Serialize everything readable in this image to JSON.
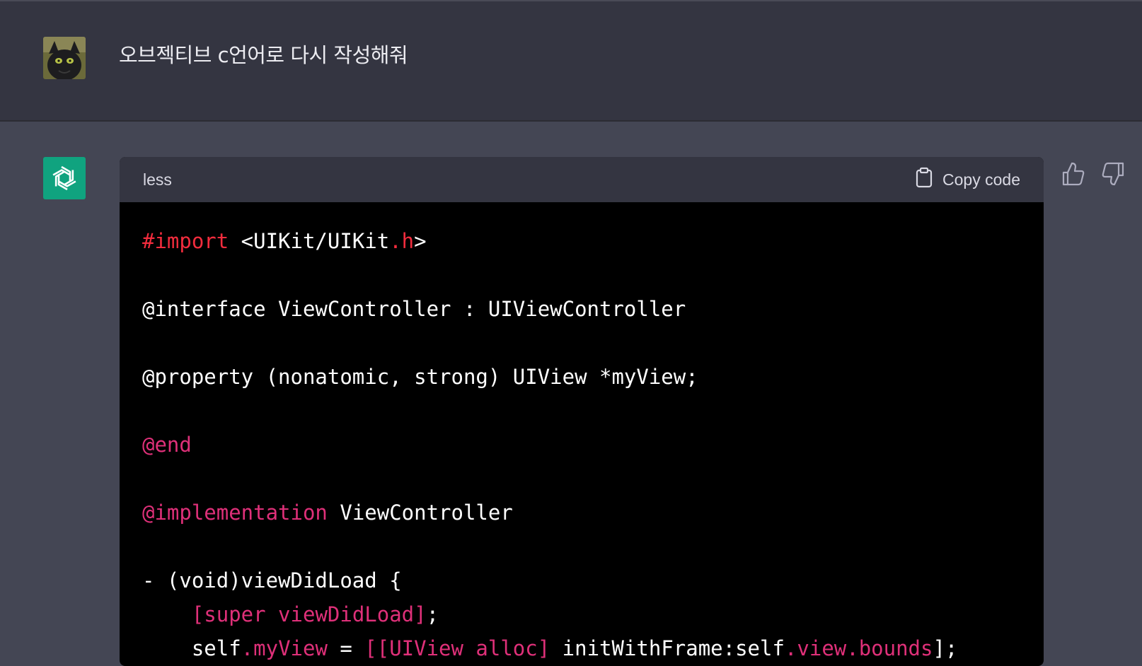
{
  "user_message": {
    "text": "오브젝티브 c언어로 다시 작성해줘"
  },
  "code_block": {
    "language": "less",
    "copy_label": "Copy code",
    "lines": [
      [
        {
          "t": "#import",
          "c": "red"
        },
        {
          "t": " <UIKit/UIKit"
        },
        {
          "t": ".h",
          "c": "red"
        },
        {
          "t": ">"
        }
      ],
      [],
      [
        {
          "t": "@interface ViewController : UIViewController"
        }
      ],
      [],
      [
        {
          "t": "@property (nonatomic, strong) UIView *myView;"
        }
      ],
      [],
      [
        {
          "t": "@end",
          "c": "pink"
        }
      ],
      [],
      [
        {
          "t": "@implementation",
          "c": "pink"
        },
        {
          "t": " ViewController"
        }
      ],
      [],
      [
        {
          "t": "- (void)viewDidLoad {"
        }
      ],
      [
        {
          "t": "    "
        },
        {
          "t": "[super viewDidLoad]",
          "c": "pink"
        },
        {
          "t": ";"
        }
      ],
      [
        {
          "t": "    self"
        },
        {
          "t": ".myView",
          "c": "pink"
        },
        {
          "t": " = "
        },
        {
          "t": "[[UIView alloc]",
          "c": "pink"
        },
        {
          "t": " initWithFrame:self"
        },
        {
          "t": ".view.bounds",
          "c": "pink"
        },
        {
          "t": "];"
        }
      ]
    ]
  },
  "colors": {
    "user_bg": "#343541",
    "assistant_bg": "#444654",
    "code_bg": "#000000",
    "accent": "#10a37f",
    "keyword_red": "#f22c3d",
    "keyword_pink": "#df3079"
  },
  "icons": [
    "user-avatar",
    "openai-logo-icon",
    "clipboard-icon",
    "thumbs-up-icon",
    "thumbs-down-icon"
  ]
}
